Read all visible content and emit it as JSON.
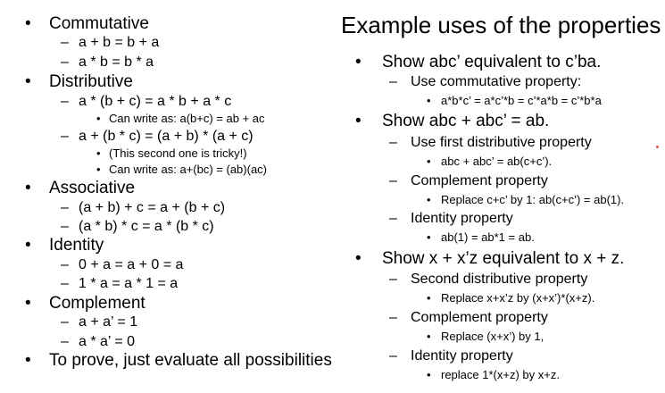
{
  "markers": {
    "l1": "•",
    "l2": "–",
    "l3": "•"
  },
  "left": [
    {
      "level": 1,
      "text": "Commutative"
    },
    {
      "level": 2,
      "text": "a + b = b + a"
    },
    {
      "level": 2,
      "text": "a * b = b * a"
    },
    {
      "level": 1,
      "text": "Distributive"
    },
    {
      "level": 2,
      "text": "a * (b + c) = a * b + a * c"
    },
    {
      "level": 3,
      "text": "Can write as: a(b+c) = ab + ac"
    },
    {
      "level": 2,
      "text": "a + (b * c) = (a + b) * (a + c)"
    },
    {
      "level": 3,
      "text": "(This second one is tricky!)"
    },
    {
      "level": 3,
      "text": "Can write as: a+(bc) = (ab)(ac)"
    },
    {
      "level": 1,
      "text": "Associative"
    },
    {
      "level": 2,
      "text": "(a + b) + c = a + (b + c)"
    },
    {
      "level": 2,
      "text": "(a * b) * c = a * (b * c)"
    },
    {
      "level": 1,
      "text": "Identity"
    },
    {
      "level": 2,
      "text": "0 + a = a + 0 = a"
    },
    {
      "level": 2,
      "text": "1 * a = a * 1 = a"
    },
    {
      "level": 1,
      "text": "Complement"
    },
    {
      "level": 2,
      "text": "a + a’ = 1"
    },
    {
      "level": 2,
      "text": "a * a’ = 0"
    },
    {
      "level": 1,
      "text": "To prove, just evaluate all possibilities"
    }
  ],
  "right": {
    "title": "Example uses of the properties",
    "items": [
      {
        "level": 1,
        "text": "Show abc’ equivalent to c’ba."
      },
      {
        "level": 2,
        "text": "Use commutative property:"
      },
      {
        "level": 3,
        "text": "a*b*c’ = a*c’*b = c’*a*b = c’*b*a"
      },
      {
        "level": 1,
        "text": "Show abc + abc’ = ab."
      },
      {
        "level": 2,
        "text": "Use first distributive property"
      },
      {
        "level": 3,
        "text": "abc + abc’ = ab(c+c’)."
      },
      {
        "level": 2,
        "text": "Complement property"
      },
      {
        "level": 3,
        "text": "Replace c+c’ by 1: ab(c+c’) = ab(1)."
      },
      {
        "level": 2,
        "text": "Identity property"
      },
      {
        "level": 3,
        "text": "ab(1) = ab*1 = ab."
      },
      {
        "level": 1,
        "text": "Show x + x’z equivalent to x + z."
      },
      {
        "level": 2,
        "text": "Second distributive property"
      },
      {
        "level": 3,
        "text": "Replace x+x’z by (x+x’)*(x+z)."
      },
      {
        "level": 2,
        "text": "Complement property"
      },
      {
        "level": 3,
        "text": "Replace (x+x’) by 1,"
      },
      {
        "level": 2,
        "text": "Identity property"
      },
      {
        "level": 3,
        "text": "replace 1*(x+z) by x+z."
      }
    ]
  }
}
